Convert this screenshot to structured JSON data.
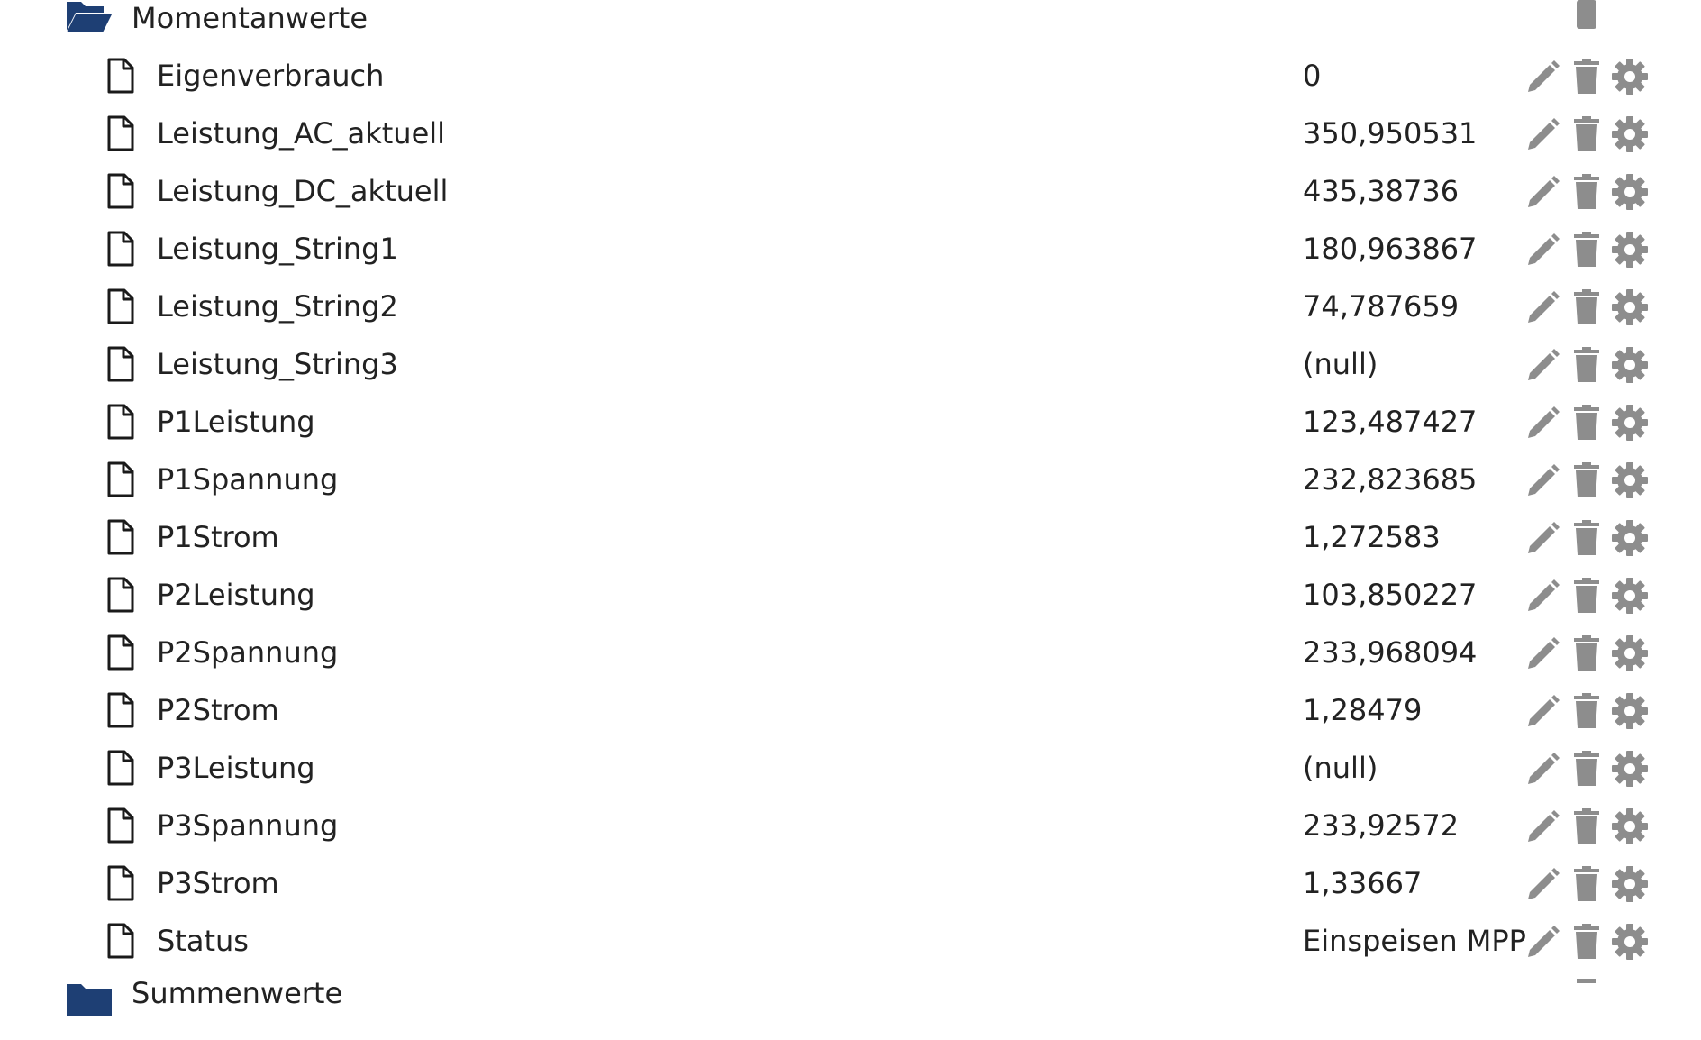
{
  "colors": {
    "folder": "#1e3f74",
    "action_icon": "#8d8d8d",
    "text": "#222222"
  },
  "folders": {
    "current": {
      "label": "Momentanwerte",
      "icon": "folder-open-icon"
    },
    "next": {
      "label": "Summenwerte",
      "icon": "folder-icon"
    }
  },
  "actions": [
    "edit-icon",
    "trash-icon",
    "gear-icon"
  ],
  "rows": [
    {
      "name": "Eigenverbrauch",
      "value": "0"
    },
    {
      "name": "Leistung_AC_aktuell",
      "value": "350,950531"
    },
    {
      "name": "Leistung_DC_aktuell",
      "value": "435,38736"
    },
    {
      "name": "Leistung_String1",
      "value": "180,963867"
    },
    {
      "name": "Leistung_String2",
      "value": "74,787659"
    },
    {
      "name": "Leistung_String3",
      "value": "(null)"
    },
    {
      "name": "P1Leistung",
      "value": "123,487427"
    },
    {
      "name": "P1Spannung",
      "value": "232,823685"
    },
    {
      "name": "P1Strom",
      "value": "1,272583"
    },
    {
      "name": "P2Leistung",
      "value": "103,850227"
    },
    {
      "name": "P2Spannung",
      "value": "233,968094"
    },
    {
      "name": "P2Strom",
      "value": "1,28479"
    },
    {
      "name": "P3Leistung",
      "value": "(null)"
    },
    {
      "name": "P3Spannung",
      "value": "233,92572"
    },
    {
      "name": "P3Strom",
      "value": "1,33667"
    },
    {
      "name": "Status",
      "value": "Einspeisen MPP"
    }
  ]
}
